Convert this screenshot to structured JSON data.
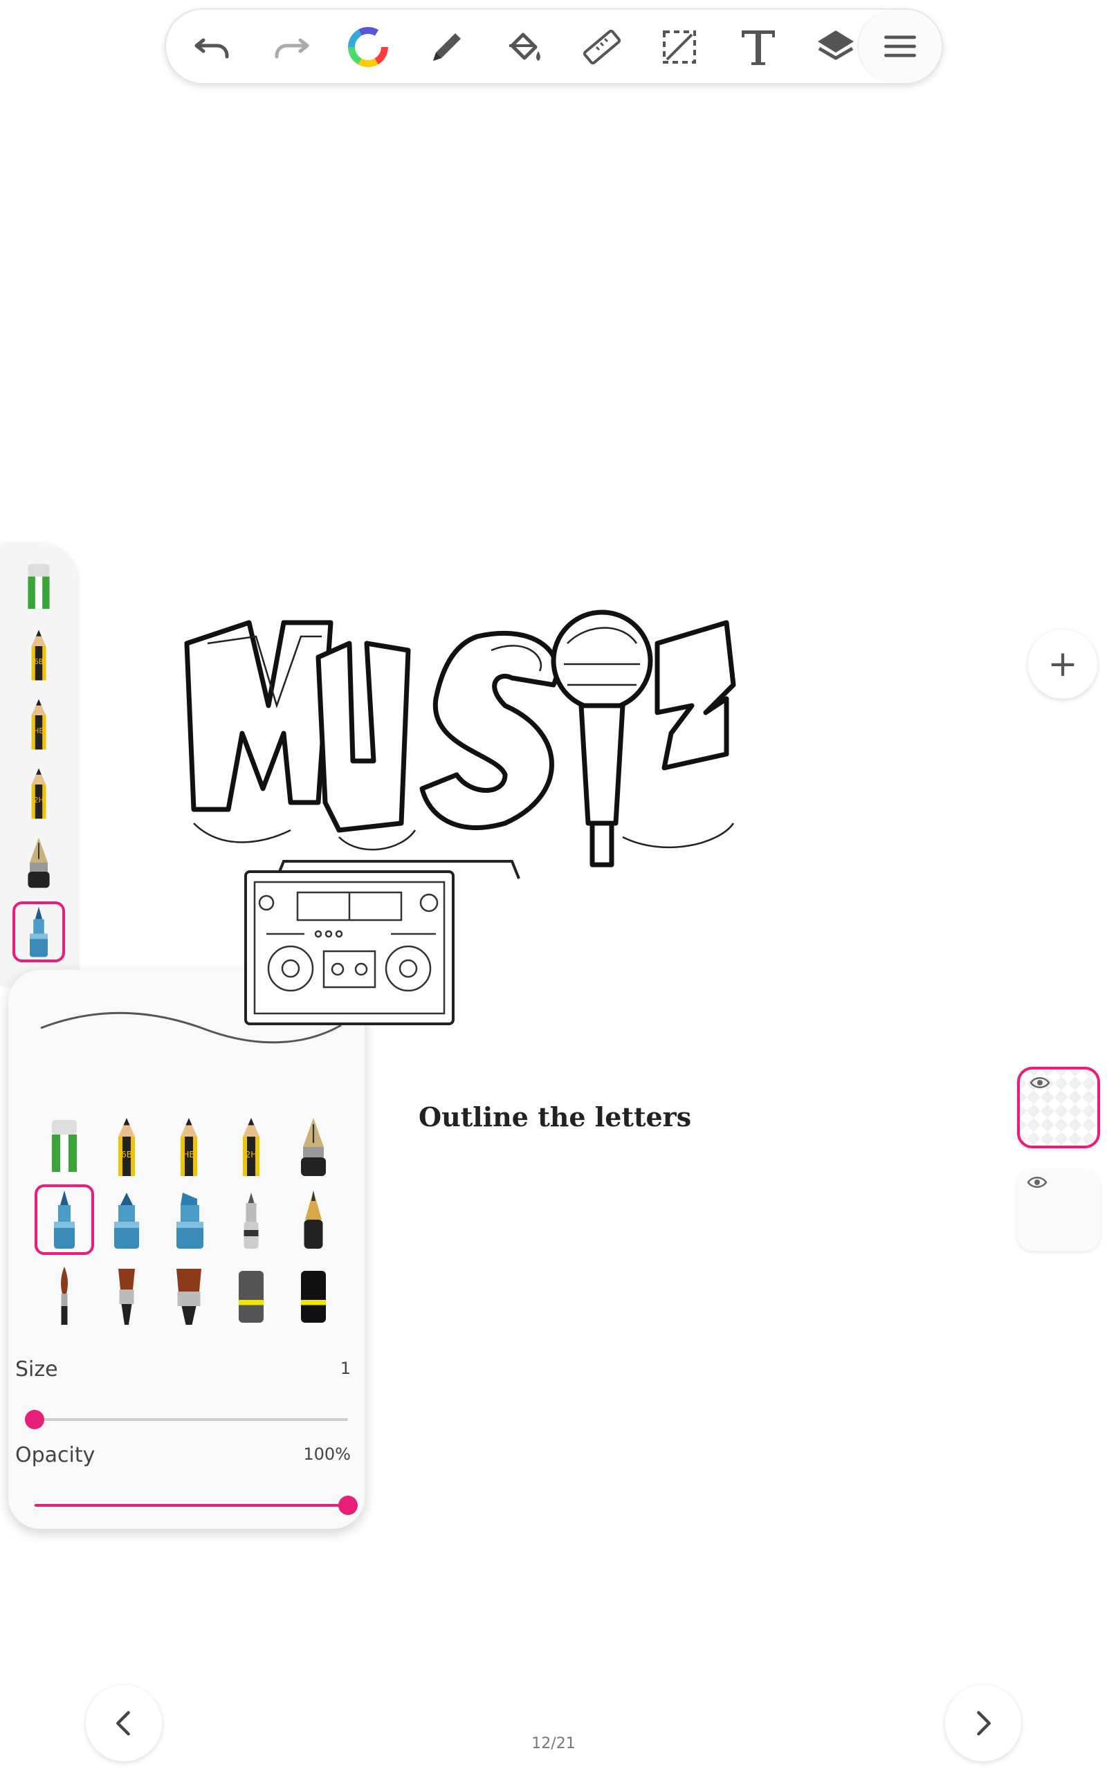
{
  "toolbar": {
    "buttons": [
      {
        "name": "undo-icon"
      },
      {
        "name": "redo-icon"
      },
      {
        "name": "color-wheel-icon"
      },
      {
        "name": "pencil-icon"
      },
      {
        "name": "paint-bucket-icon"
      },
      {
        "name": "ruler-icon"
      },
      {
        "name": "selection-icon"
      },
      {
        "name": "text-icon"
      },
      {
        "name": "layers-icon"
      },
      {
        "name": "menu-icon"
      }
    ]
  },
  "brush_rail": {
    "items": [
      "eraser",
      "pencil-6b",
      "pencil-hb",
      "pencil-2h",
      "fountain-pen",
      "marker"
    ],
    "selected": "marker"
  },
  "brush_panel": {
    "brushes": [
      [
        "eraser",
        "pencil-6b",
        "pencil-hb",
        "pencil-2h",
        "fountain-pen"
      ],
      [
        "marker",
        "marker-wide",
        "marker-chisel",
        "airbrush",
        "gold-pen"
      ],
      [
        "fine-brush",
        "flat-brush",
        "wide-brush",
        "gray-block",
        "black-block"
      ]
    ],
    "selected": "marker",
    "size_label": "Size",
    "size_value": "1",
    "size_fraction": 0.0,
    "opacity_label": "Opacity",
    "opacity_value": "100%",
    "opacity_fraction": 1.0
  },
  "pencil_codes": {
    "b6": "6B",
    "hb": "HB",
    "h2": "2H"
  },
  "canvas": {
    "caption": "Outline the letters"
  },
  "layers": [
    {
      "active": true
    },
    {
      "active": false
    }
  ],
  "pagination": {
    "label": "12/21"
  },
  "colors": {
    "accent": "#e91e7a"
  }
}
